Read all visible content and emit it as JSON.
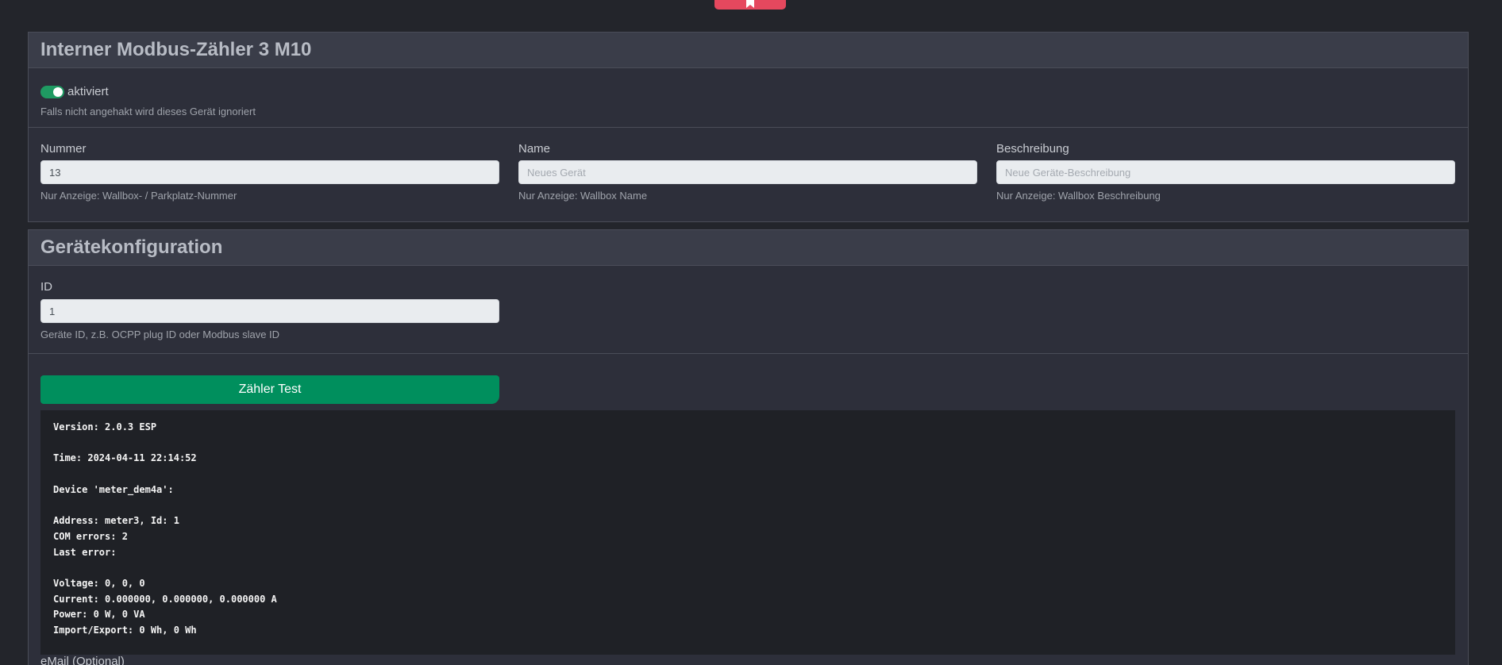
{
  "card1": {
    "title": "Interner Modbus-Zähler 3 M10",
    "toggle": {
      "label": "aktiviert",
      "on": true,
      "hint": "Falls nicht angehakt wird dieses Gerät ignoriert"
    },
    "fields": [
      {
        "label": "Nummer",
        "value": "13",
        "placeholder": "",
        "hint": "Nur Anzeige: Wallbox- / Parkplatz-Nummer"
      },
      {
        "label": "Name",
        "value": "",
        "placeholder": "Neues Gerät",
        "hint": "Nur Anzeige: Wallbox Name"
      },
      {
        "label": "Beschreibung",
        "value": "",
        "placeholder": "Neue Geräte-Beschreibung",
        "hint": "Nur Anzeige: Wallbox Beschreibung"
      }
    ]
  },
  "card2": {
    "title": "Gerätekonfiguration",
    "id_field": {
      "label": "ID",
      "value": "1",
      "hint": "Geräte ID, z.B. OCPP plug ID oder Modbus slave ID"
    },
    "test_button": "Zähler Test",
    "console": {
      "version": "Version: 2.0.3 ESP",
      "time": "Time: 2024-04-11 22:14:52",
      "device": "Device 'meter_dem4a':",
      "address": "Address: meter3, Id: 1",
      "com_errors": "COM errors: 2",
      "last_error": "Last error:",
      "voltage": "Voltage: 0, 0, 0",
      "current": "Current: 0.000000, 0.000000, 0.000000 A",
      "power": "Power: 0 W, 0 VA",
      "import_export": "Import/Export: 0 Wh, 0 Wh"
    },
    "email_label": "eMail (Optional)"
  },
  "colors": {
    "accent_green": "#008f5d",
    "toggle_green": "#1f9a62",
    "top_tab": "#e5485e",
    "background": "#23252b"
  }
}
